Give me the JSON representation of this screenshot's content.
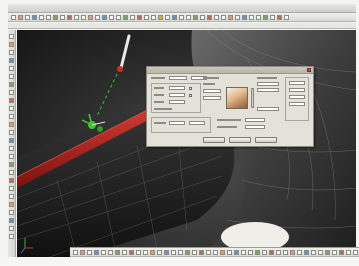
{
  "window": {
    "title": ""
  },
  "colors": {
    "viewport_dark": "#2c2c2c",
    "tube_red": "#b01f1a",
    "gizmo_green": "#3fae2c",
    "probe_red": "#d42a1f",
    "dialog_bg": "#e4e1d8"
  },
  "toolbars": {
    "top_icon_count": 40,
    "left_icon_count": 26,
    "bottom_icon_count": 44
  },
  "icons": {
    "tool": "toolbar-tool-icon",
    "gizmo": "move-gizmo-icon",
    "probe": "probe-icon",
    "axis": "axis-triad-icon",
    "close": "close-icon"
  },
  "dialog": {
    "title": "",
    "buttons": [
      "",
      "",
      ""
    ]
  }
}
